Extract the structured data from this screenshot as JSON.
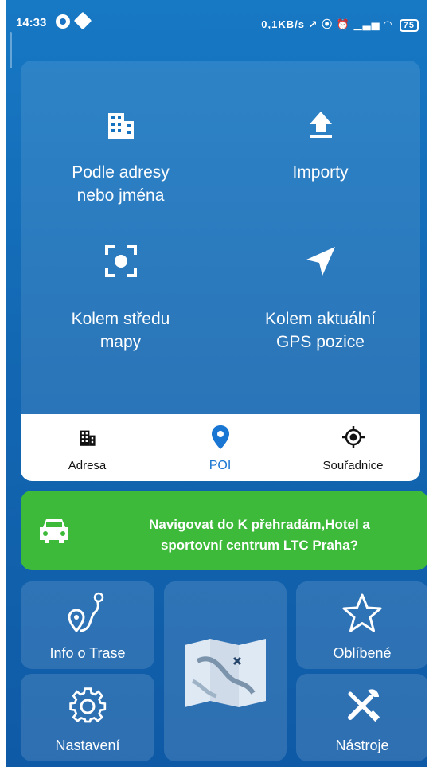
{
  "status_bar": {
    "time": "14:33",
    "right_text": "0,1KB/s",
    "battery": "75"
  },
  "search_options": [
    {
      "label_line1": "Podle adresy",
      "label_line2": "nebo jména",
      "icon": "building-icon"
    },
    {
      "label_line1": "Importy",
      "label_line2": "",
      "icon": "upload-icon"
    },
    {
      "label_line1": "Kolem středu",
      "label_line2": "mapy",
      "icon": "map-center-icon"
    },
    {
      "label_line1": "Kolem aktuální",
      "label_line2": "GPS pozice",
      "icon": "navigation-arrow-icon"
    }
  ],
  "tabs": [
    {
      "label": "Adresa",
      "icon": "building-icon",
      "active": false
    },
    {
      "label": "POI",
      "icon": "map-pin-icon",
      "active": true
    },
    {
      "label": "Souřadnice",
      "icon": "crosshair-icon",
      "active": false
    }
  ],
  "navigate_banner": {
    "line1": "Navigovat do K přehradám,Hotel a",
    "line2": "sportovní centrum LTC Praha?"
  },
  "tiles": {
    "route_info": "Info o Trase",
    "settings": "Nastavení",
    "favorites": "Oblíbené",
    "tools": "Nástroje"
  },
  "colors": {
    "background": "#1368b3",
    "banner_green": "#3dba3a",
    "active_tab": "#1976d2"
  }
}
